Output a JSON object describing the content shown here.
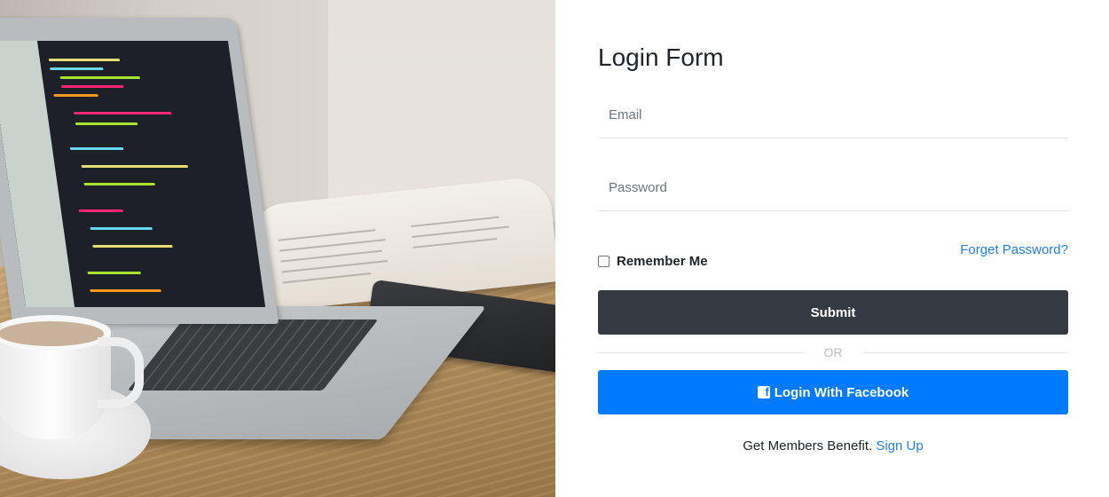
{
  "login_form": {
    "title": "Login Form",
    "email_placeholder": "Email",
    "password_placeholder": "Password",
    "remember_label": "Remember Me",
    "remember_checked": false,
    "forgot_link": "Forget Password?",
    "submit_label": "Submit",
    "divider_text": "OR",
    "facebook_label": "Login With Facebook",
    "facebook_icon": "facebook-icon",
    "signup_prompt": "Get Members Benefit.",
    "signup_link": "Sign Up"
  },
  "colors": {
    "submit_bg": "#343a40",
    "facebook_bg": "#007bff",
    "link": "#2a7ed3"
  }
}
